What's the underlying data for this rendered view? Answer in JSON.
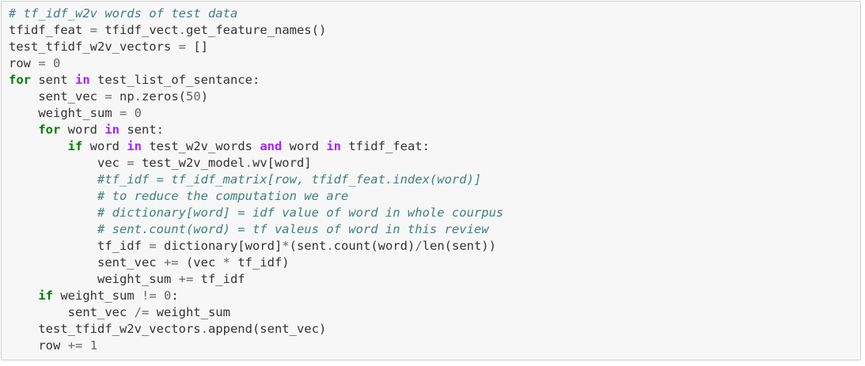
{
  "cell": {
    "lines": [
      [
        {
          "t": "cm",
          "v": "# tf_idf_w2v words of test data"
        }
      ],
      [
        {
          "t": "n",
          "v": "tfidf_feat "
        },
        {
          "t": "op",
          "v": "="
        },
        {
          "t": "n",
          "v": " tfidf_vect"
        },
        {
          "t": "op",
          "v": "."
        },
        {
          "t": "n",
          "v": "get_feature_names()"
        }
      ],
      [
        {
          "t": "n",
          "v": "test_tfidf_w2v_vectors "
        },
        {
          "t": "op",
          "v": "="
        },
        {
          "t": "n",
          "v": " []"
        }
      ],
      [
        {
          "t": "n",
          "v": "row "
        },
        {
          "t": "op",
          "v": "="
        },
        {
          "t": "n",
          "v": " "
        },
        {
          "t": "mi",
          "v": "0"
        }
      ],
      [
        {
          "t": "kw",
          "v": "for"
        },
        {
          "t": "n",
          "v": " sent "
        },
        {
          "t": "ow",
          "v": "in"
        },
        {
          "t": "n",
          "v": " test_list_of_sentance:"
        }
      ],
      [
        {
          "t": "n",
          "v": "    sent_vec "
        },
        {
          "t": "op",
          "v": "="
        },
        {
          "t": "n",
          "v": " np"
        },
        {
          "t": "op",
          "v": "."
        },
        {
          "t": "n",
          "v": "zeros("
        },
        {
          "t": "mi",
          "v": "50"
        },
        {
          "t": "n",
          "v": ")"
        }
      ],
      [
        {
          "t": "n",
          "v": "    weight_sum "
        },
        {
          "t": "op",
          "v": "="
        },
        {
          "t": "n",
          "v": " "
        },
        {
          "t": "mi",
          "v": "0"
        }
      ],
      [
        {
          "t": "n",
          "v": "    "
        },
        {
          "t": "kw",
          "v": "for"
        },
        {
          "t": "n",
          "v": " word "
        },
        {
          "t": "ow",
          "v": "in"
        },
        {
          "t": "n",
          "v": " sent:"
        }
      ],
      [
        {
          "t": "n",
          "v": "        "
        },
        {
          "t": "kw",
          "v": "if"
        },
        {
          "t": "n",
          "v": " word "
        },
        {
          "t": "ow",
          "v": "in"
        },
        {
          "t": "n",
          "v": " test_w2v_words "
        },
        {
          "t": "ow",
          "v": "and"
        },
        {
          "t": "n",
          "v": " word "
        },
        {
          "t": "ow",
          "v": "in"
        },
        {
          "t": "n",
          "v": " tfidf_feat:"
        }
      ],
      [
        {
          "t": "n",
          "v": "            vec "
        },
        {
          "t": "op",
          "v": "="
        },
        {
          "t": "n",
          "v": " test_w2v_model"
        },
        {
          "t": "op",
          "v": "."
        },
        {
          "t": "n",
          "v": "wv[word]"
        }
      ],
      [
        {
          "t": "n",
          "v": "            "
        },
        {
          "t": "cm",
          "v": "#tf_idf = tf_idf_matrix[row, tfidf_feat.index(word)]"
        }
      ],
      [
        {
          "t": "n",
          "v": "            "
        },
        {
          "t": "cm",
          "v": "# to reduce the computation we are"
        }
      ],
      [
        {
          "t": "n",
          "v": "            "
        },
        {
          "t": "cm",
          "v": "# dictionary[word] = idf value of word in whole courpus"
        }
      ],
      [
        {
          "t": "n",
          "v": "            "
        },
        {
          "t": "cm",
          "v": "# sent.count(word) = tf valeus of word in this review"
        }
      ],
      [
        {
          "t": "n",
          "v": "            tf_idf "
        },
        {
          "t": "op",
          "v": "="
        },
        {
          "t": "n",
          "v": " dictionary[word]"
        },
        {
          "t": "op",
          "v": "*"
        },
        {
          "t": "n",
          "v": "(sent"
        },
        {
          "t": "op",
          "v": "."
        },
        {
          "t": "n",
          "v": "count(word)"
        },
        {
          "t": "op",
          "v": "/"
        },
        {
          "t": "n",
          "v": "len(sent))"
        }
      ],
      [
        {
          "t": "n",
          "v": "            sent_vec "
        },
        {
          "t": "op",
          "v": "+="
        },
        {
          "t": "n",
          "v": " (vec "
        },
        {
          "t": "op",
          "v": "*"
        },
        {
          "t": "n",
          "v": " tf_idf)"
        }
      ],
      [
        {
          "t": "n",
          "v": "            weight_sum "
        },
        {
          "t": "op",
          "v": "+="
        },
        {
          "t": "n",
          "v": " tf_idf"
        }
      ],
      [
        {
          "t": "n",
          "v": "    "
        },
        {
          "t": "kw",
          "v": "if"
        },
        {
          "t": "n",
          "v": " weight_sum "
        },
        {
          "t": "op",
          "v": "!="
        },
        {
          "t": "n",
          "v": " "
        },
        {
          "t": "mi",
          "v": "0"
        },
        {
          "t": "n",
          "v": ":"
        }
      ],
      [
        {
          "t": "n",
          "v": "        sent_vec "
        },
        {
          "t": "op",
          "v": "/="
        },
        {
          "t": "n",
          "v": " weight_sum"
        }
      ],
      [
        {
          "t": "n",
          "v": "    test_tfidf_w2v_vectors"
        },
        {
          "t": "op",
          "v": "."
        },
        {
          "t": "n",
          "v": "append(sent_vec)"
        }
      ],
      [
        {
          "t": "n",
          "v": "    row "
        },
        {
          "t": "op",
          "v": "+="
        },
        {
          "t": "n",
          "v": " "
        },
        {
          "t": "mi",
          "v": "1"
        }
      ]
    ]
  }
}
